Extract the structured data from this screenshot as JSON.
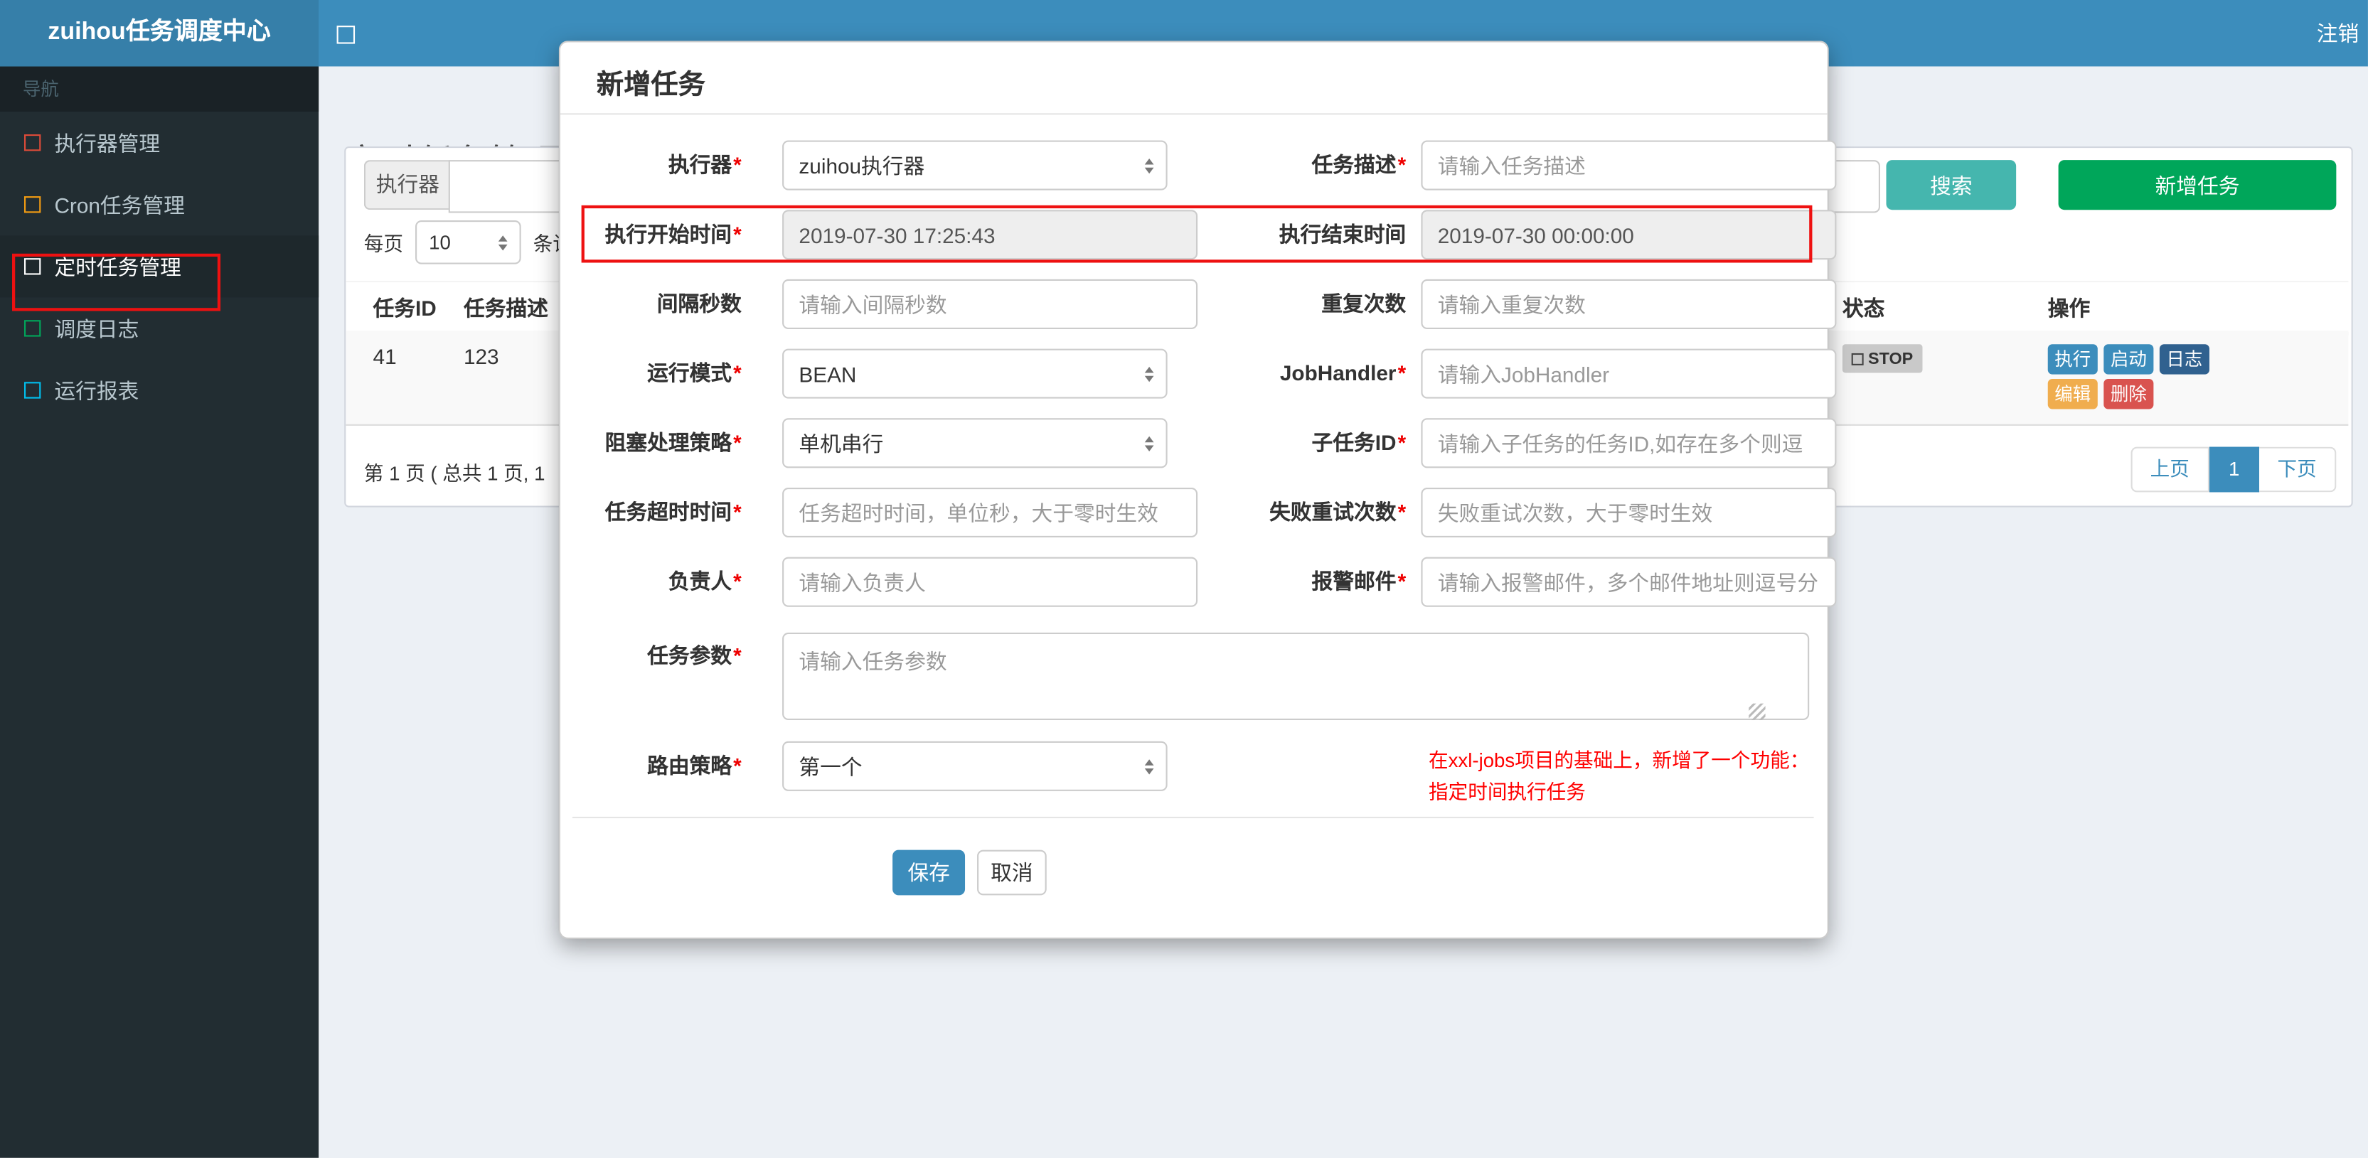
{
  "navbar": {
    "brand": "zuihou任务调度中心",
    "logout": "注销"
  },
  "sidebar": {
    "header": "导航",
    "items": [
      {
        "label": "执行器管理"
      },
      {
        "label": "Cron任务管理"
      },
      {
        "label": "定时任务管理"
      },
      {
        "label": "调度日志"
      },
      {
        "label": "运行报表"
      }
    ]
  },
  "page": {
    "title": "定时任务管理",
    "filter": {
      "executor_label": "执行器"
    },
    "buttons": {
      "search": "搜索",
      "add": "新增任务"
    },
    "per_page": {
      "prefix": "每页",
      "value": "10",
      "suffix": "条记"
    },
    "table": {
      "headers": {
        "id": "任务ID",
        "desc": "任务描述",
        "status": "状态",
        "actions": "操作"
      },
      "row": {
        "id": "41",
        "desc": "123",
        "status": "STOP",
        "actions": {
          "run": "执行",
          "start": "启动",
          "log": "日志",
          "edit": "编辑",
          "del": "删除"
        }
      }
    },
    "pagination": {
      "summary": "第 1 页 ( 总共 1 页, 1",
      "prev": "上页",
      "current": "1",
      "next": "下页"
    }
  },
  "modal": {
    "title": "新增任务",
    "star": "*",
    "rows": [
      {
        "left": {
          "label": "执行器",
          "value": "zuihou执行器"
        },
        "right": {
          "label": "任务描述",
          "placeholder": "请输入任务描述"
        }
      },
      {
        "left": {
          "label": "执行开始时间",
          "value": "2019-07-30 17:25:43"
        },
        "right": {
          "label": "执行结束时间",
          "value": "2019-07-30 00:00:00"
        }
      },
      {
        "left": {
          "label": "间隔秒数",
          "placeholder": "请输入间隔秒数"
        },
        "right": {
          "label": "重复次数",
          "placeholder": "请输入重复次数"
        }
      },
      {
        "left": {
          "label": "运行模式",
          "value": "BEAN"
        },
        "right": {
          "label": "JobHandler",
          "placeholder": "请输入JobHandler"
        }
      },
      {
        "left": {
          "label": "阻塞处理策略",
          "value": "单机串行"
        },
        "right": {
          "label": "子任务ID",
          "placeholder": "请输入子任务的任务ID,如存在多个则逗"
        }
      },
      {
        "left": {
          "label": "任务超时时间",
          "placeholder": "任务超时时间，单位秒，大于零时生效"
        },
        "right": {
          "label": "失败重试次数",
          "placeholder": "失败重试次数，大于零时生效"
        }
      },
      {
        "left": {
          "label": "负责人",
          "placeholder": "请输入负责人"
        },
        "right": {
          "label": "报警邮件",
          "placeholder": "请输入报警邮件，多个邮件地址则逗号分"
        }
      }
    ],
    "params": {
      "label": "任务参数",
      "placeholder": "请输入任务参数"
    },
    "route": {
      "label": "路由策略",
      "value": "第一个"
    },
    "note_line1": "在xxl-jobs项目的基础上，新增了一个功能：",
    "note_line2": "指定时间执行任务",
    "footer": {
      "save": "保存",
      "cancel": "取消"
    }
  },
  "colors": {
    "navbar": "#3c8dbc",
    "logo": "#367fa9",
    "sidebar": "#222d32",
    "sidebar_header": "#1a2226",
    "primary": "#3c8dbc",
    "info": "#45b6ae",
    "success": "#00a65a",
    "warning": "#f0ad4e",
    "danger": "#d9534f",
    "annotation": "#ee1111",
    "menu_red": "#dd4b39",
    "menu_orange": "#f39c12",
    "menu_white": "#ffffff",
    "menu_green": "#00a65a",
    "menu_cyan": "#00c0ef"
  }
}
